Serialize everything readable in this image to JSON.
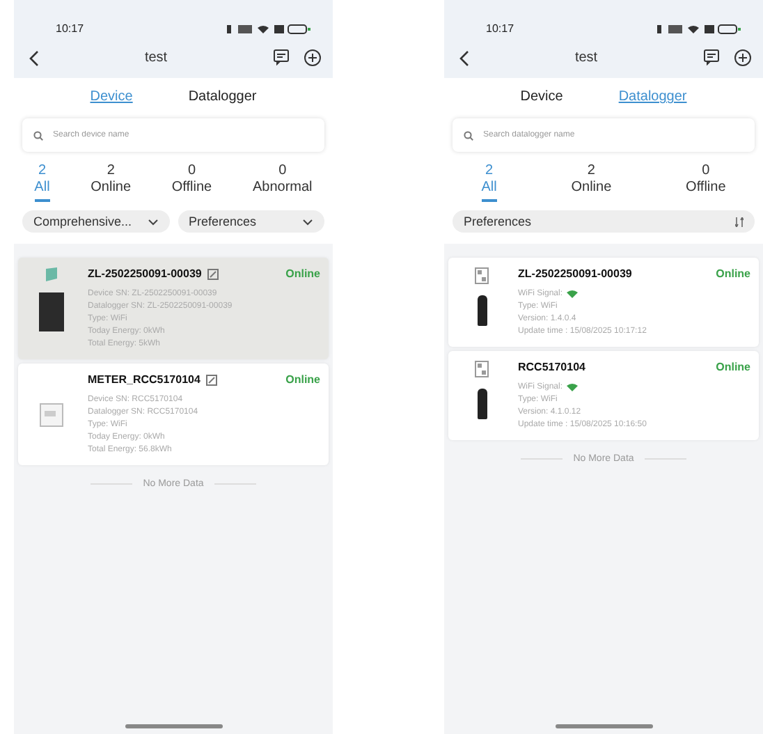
{
  "phones": [
    {
      "kind": "device",
      "status_bar": {
        "time": "10:17"
      },
      "title": "test",
      "tabs": [
        {
          "label": "Device",
          "selected": true
        },
        {
          "label": "Datalogger",
          "selected": false
        }
      ],
      "search": {
        "placeholder": "Search device name"
      },
      "filters": [
        {
          "count": "2",
          "label": "All",
          "selected": true
        },
        {
          "count": "2",
          "label": "Online",
          "selected": false
        },
        {
          "count": "0",
          "label": "Offline",
          "selected": false
        },
        {
          "count": "0",
          "label": "Abnormal",
          "selected": false
        }
      ],
      "dropdowns": [
        {
          "label": "Comprehensive..."
        },
        {
          "label": "Preferences"
        }
      ],
      "cards": [
        {
          "name": "ZL-2502250091-00039",
          "status": "Online",
          "selected": true,
          "flagged": true,
          "lines": [
            "Device SN: ZL-2502250091-00039",
            "Datalogger SN: ZL-2502250091-00039",
            "Type: WiFi",
            "Today Energy: 0kWh",
            "Total Energy: 5kWh"
          ]
        },
        {
          "name": "METER_RCC5170104",
          "status": "Online",
          "selected": false,
          "flagged": false,
          "lines": [
            "Device SN: RCC5170104",
            "Datalogger SN: RCC5170104",
            "Type: WiFi",
            "Today Energy: 0kWh",
            "Total Energy: 56.8kWh"
          ]
        }
      ],
      "footer": "No More Data"
    },
    {
      "kind": "datalogger",
      "status_bar": {
        "time": "10:17"
      },
      "title": "test",
      "tabs": [
        {
          "label": "Device",
          "selected": false
        },
        {
          "label": "Datalogger",
          "selected": true
        }
      ],
      "search": {
        "placeholder": "Search datalogger name"
      },
      "filters": [
        {
          "count": "2",
          "label": "All",
          "selected": true
        },
        {
          "count": "2",
          "label": "Online",
          "selected": false
        },
        {
          "count": "0",
          "label": "Offline",
          "selected": false
        }
      ],
      "dropdowns": [
        {
          "label": "Preferences"
        }
      ],
      "cards": [
        {
          "name": "ZL-2502250091-00039",
          "status": "Online",
          "selected": false,
          "signal_label": "WiFi Signal:",
          "lines": [
            "Type: WiFi",
            "Version: 1.4.0.4",
            "Update time : 15/08/2025 10:17:12"
          ]
        },
        {
          "name": "RCC5170104",
          "status": "Online",
          "selected": false,
          "signal_label": "WiFi Signal:",
          "lines": [
            "Type: WiFi",
            "Version: 4.1.0.12",
            "Update time : 15/08/2025 10:16:50"
          ]
        }
      ],
      "footer": "No More Data"
    }
  ]
}
